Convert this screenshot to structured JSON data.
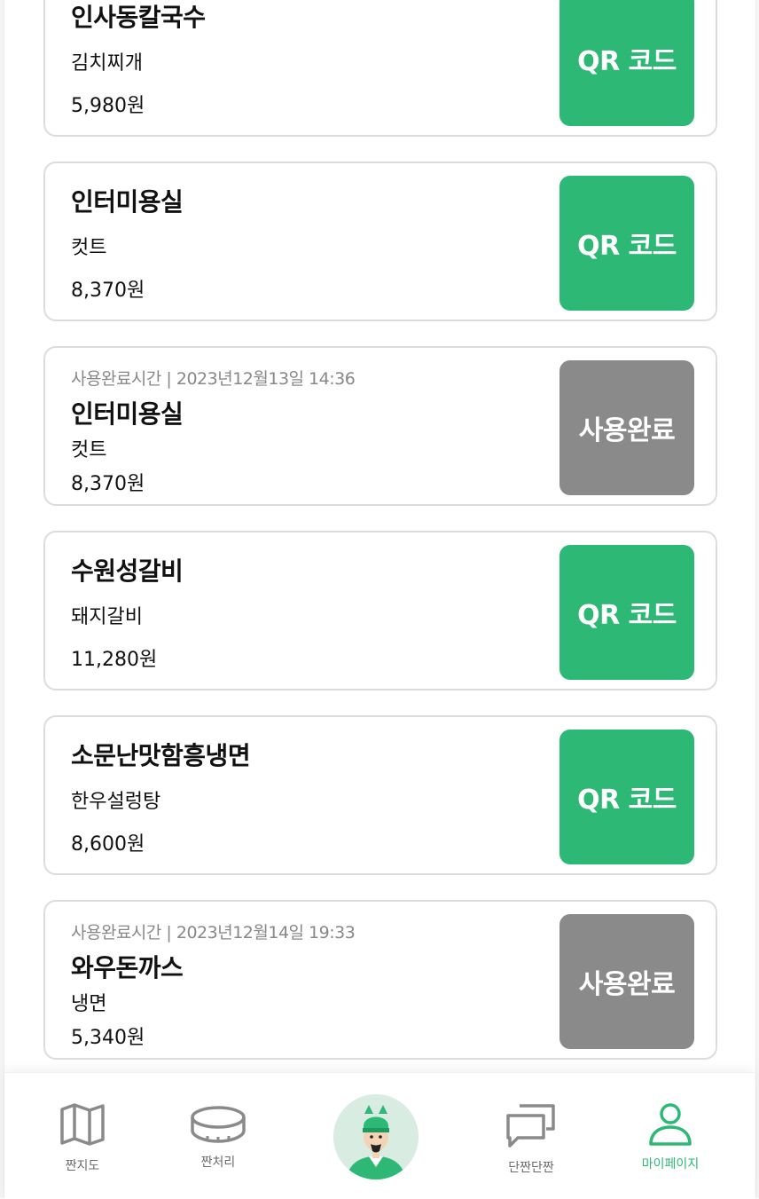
{
  "colors": {
    "accent": "#2db975",
    "used_button": "#8a8a8a",
    "card_border": "#dcdcdc",
    "muted_text": "#888888"
  },
  "cards": [
    {
      "status": "active",
      "store": "인사동칼국수",
      "menu": "김치찌개",
      "price": "5,980원",
      "action_label": "QR 코드"
    },
    {
      "status": "active",
      "store": "인터미용실",
      "menu": "컷트",
      "price": "8,370원",
      "action_label": "QR 코드"
    },
    {
      "status": "used",
      "used_time": "사용완료시간 | 2023년12월13일 14:36",
      "store": "인터미용실",
      "menu": "컷트",
      "price": "8,370원",
      "action_label": "사용완료"
    },
    {
      "status": "active",
      "store": "수원성갈비",
      "menu": "돼지갈비",
      "price": "11,280원",
      "action_label": "QR 코드"
    },
    {
      "status": "active",
      "store": "소문난맛함흥냉면",
      "menu": "한우설렁탕",
      "price": "8,600원",
      "action_label": "QR 코드"
    },
    {
      "status": "used",
      "used_time": "사용완료시간 | 2023년12월14일 19:33",
      "store": "와우돈까스",
      "menu": "냉면",
      "price": "5,340원",
      "action_label": "사용완료"
    }
  ],
  "nav": {
    "map": {
      "label": "짠지도",
      "icon": "map-icon"
    },
    "coin": {
      "label": "짠처리",
      "icon": "coin-icon"
    },
    "center": {
      "icon": "mascot-icon"
    },
    "chat": {
      "label": "단짠단짠",
      "icon": "chat-icon"
    },
    "mypage": {
      "label": "마이페이지",
      "icon": "user-icon",
      "selected": true
    }
  }
}
